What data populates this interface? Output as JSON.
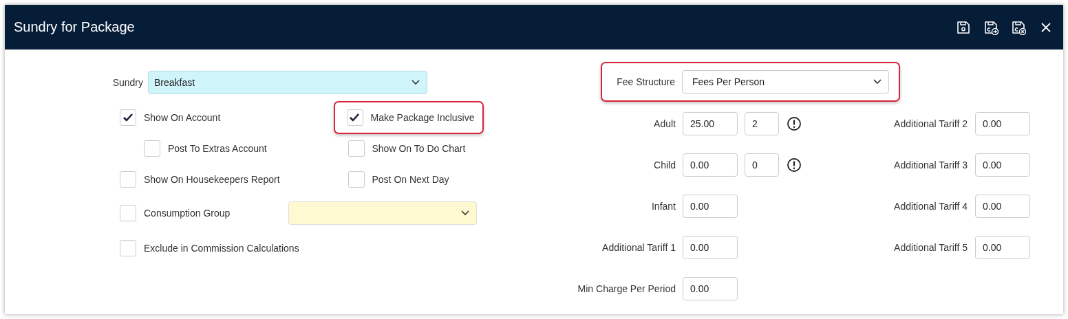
{
  "window": {
    "title": "Sundry for Package"
  },
  "toolbar": [
    {
      "kind": "save"
    },
    {
      "kind": "save-next"
    },
    {
      "kind": "save-close"
    },
    {
      "kind": "close"
    }
  ],
  "sundry": {
    "label": "Sundry",
    "value": "Breakfast"
  },
  "options": [
    {
      "items": [
        {
          "kind": "checkbox",
          "label": "Show On Account",
          "checked": true,
          "highlighted": false
        },
        {
          "kind": "checkbox",
          "label": "Make Package Inclusive",
          "checked": true,
          "highlighted": true
        }
      ]
    },
    {
      "items": [
        {
          "kind": "sub-checkbox",
          "label": "Post To Extras Account",
          "checked": false,
          "highlighted": false
        },
        {
          "kind": "checkbox",
          "label": "Show On To Do Chart",
          "checked": false,
          "highlighted": false
        }
      ]
    },
    {
      "items": [
        {
          "kind": "checkbox",
          "label": "Show On Housekeepers Report",
          "checked": false,
          "highlighted": false
        },
        {
          "kind": "checkbox",
          "label": "Post On Next Day",
          "checked": false,
          "highlighted": false
        }
      ]
    },
    {
      "items": [
        {
          "kind": "checkbox",
          "label": "Consumption Group",
          "checked": false,
          "highlighted": false
        },
        {
          "kind": "select"
        }
      ]
    },
    {
      "items": [
        {
          "kind": "checkbox",
          "label": "Exclude in Commission Calculations",
          "checked": false,
          "highlighted": false
        }
      ]
    }
  ],
  "fee_structure": {
    "label": "Fee Structure",
    "value": "Fees Per Person",
    "highlighted": true
  },
  "fee_rows": [
    {
      "left": {
        "label": "Adult",
        "value": "25.00",
        "count": "2",
        "warning": true
      },
      "right": {
        "label": "Additional Tariff 2",
        "value": "0.00"
      }
    },
    {
      "left": {
        "label": "Child",
        "value": "0.00",
        "count": "0",
        "warning": true
      },
      "right": {
        "label": "Additional Tariff 3",
        "value": "0.00"
      }
    },
    {
      "left": {
        "label": "Infant",
        "value": "0.00",
        "warning": false
      },
      "right": {
        "label": "Additional Tariff 4",
        "value": "0.00"
      }
    },
    {
      "left": {
        "label": "Additional Tariff 1",
        "value": "0.00",
        "warning": false
      },
      "right": {
        "label": "Additional Tariff 5",
        "value": "0.00"
      }
    },
    {
      "left": {
        "label": "Min Charge Per Period",
        "value": "0.00",
        "warning": false
      }
    }
  ]
}
